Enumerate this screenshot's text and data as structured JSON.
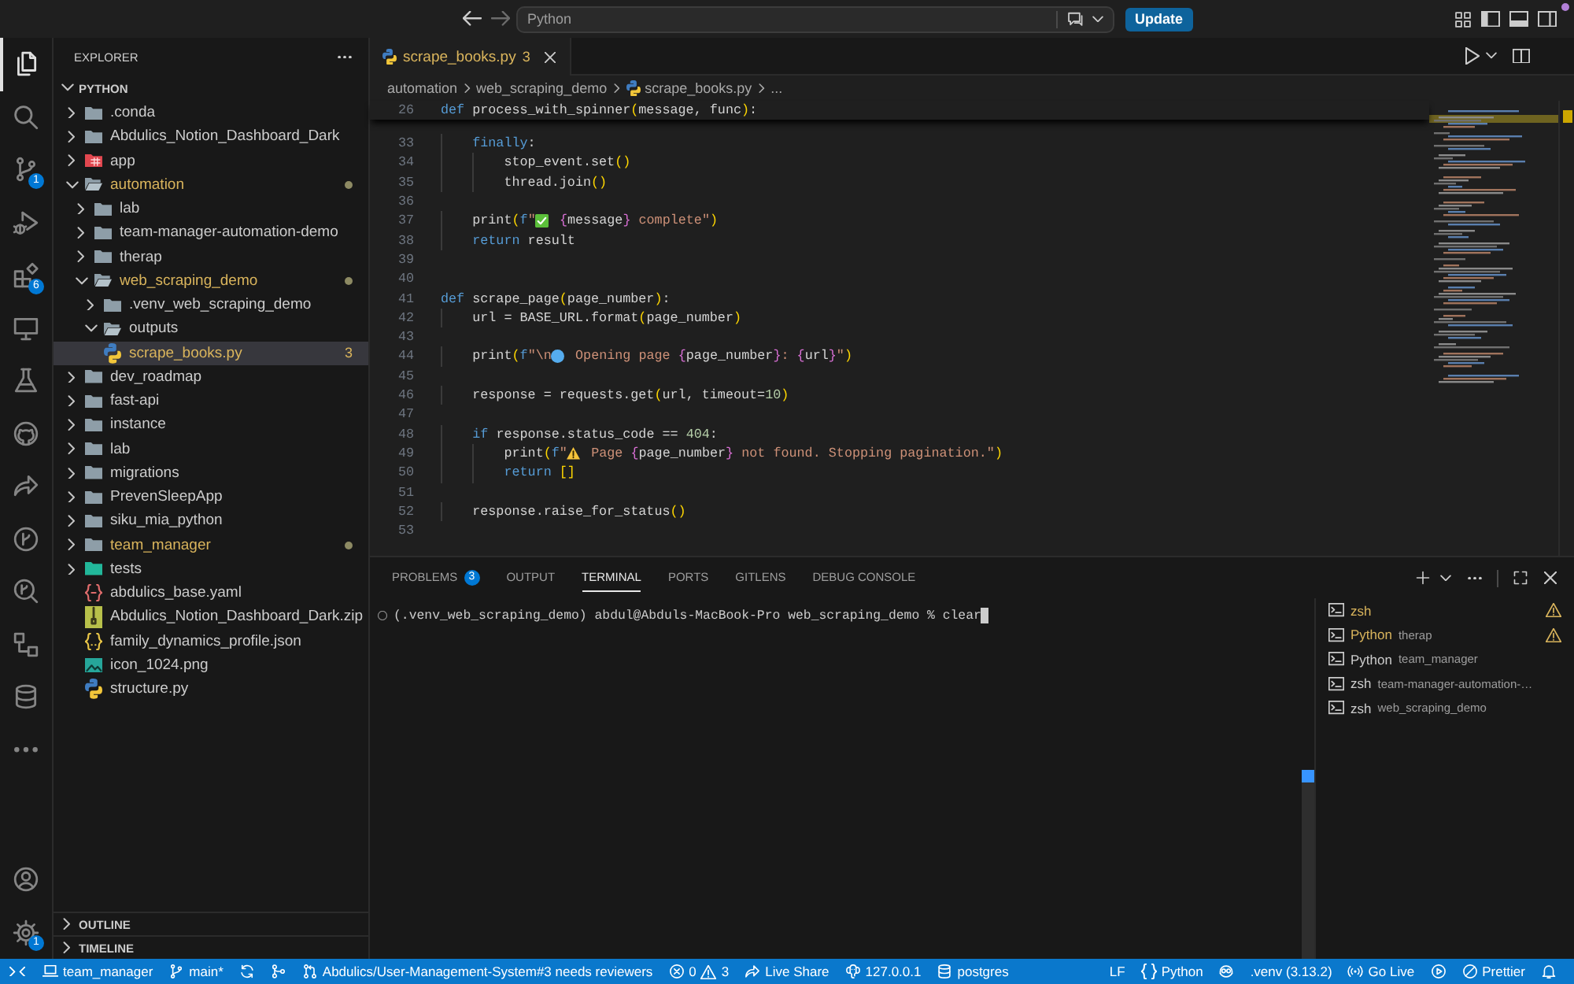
{
  "title_bar": {
    "workspace": "Python",
    "update_button": "Update"
  },
  "activity_bar": {
    "items": [
      {
        "kind": "files",
        "selected": true
      },
      {
        "kind": "search",
        "selected": false
      },
      {
        "kind": "branch",
        "selected": false,
        "badge": "1"
      },
      {
        "kind": "debug",
        "selected": false
      },
      {
        "kind": "blocks",
        "selected": false,
        "badge": "6"
      },
      {
        "kind": "monitor",
        "selected": false
      },
      {
        "kind": "flask",
        "selected": false
      },
      {
        "kind": "cat",
        "selected": false
      },
      {
        "kind": "share",
        "selected": false
      },
      {
        "kind": "gitlens",
        "selected": false
      },
      {
        "kind": "inspect",
        "selected": false
      },
      {
        "kind": "nodes",
        "selected": false
      },
      {
        "kind": "database",
        "selected": false
      },
      {
        "kind": "more",
        "selected": false
      }
    ],
    "bottom_items": [
      {
        "kind": "account"
      },
      {
        "kind": "gear",
        "badge": "1"
      }
    ]
  },
  "explorer": {
    "title": "EXPLORER",
    "section": {
      "label": "PYTHON",
      "expanded": true
    },
    "items": [
      {
        "name": ".conda",
        "kind": "folder",
        "expanded": false,
        "selected": false,
        "warning": false
      },
      {
        "name": "Abdulics_Notion_Dashboard_Dark",
        "kind": "folder",
        "expanded": false,
        "selected": false,
        "warning": false
      },
      {
        "name": "app",
        "kind": "appfolder",
        "expanded": false,
        "selected": false,
        "warning": false
      },
      {
        "name": "automation",
        "kind": "folder",
        "expanded": true,
        "selected": false,
        "warning": true,
        "children": [
          {
            "name": "lab",
            "kind": "folder",
            "expanded": false,
            "selected": false,
            "warning": false
          },
          {
            "name": "team-manager-automation-demo",
            "kind": "folder",
            "expanded": false,
            "selected": false,
            "warning": false
          },
          {
            "name": "therap",
            "kind": "folder",
            "expanded": false,
            "selected": false,
            "warning": false
          },
          {
            "name": "web_scraping_demo",
            "kind": "folder",
            "expanded": true,
            "selected": false,
            "warning": true,
            "children": [
              {
                "name": ".venv_web_scraping_demo",
                "kind": "folder",
                "expanded": false,
                "selected": false,
                "warning": false
              },
              {
                "name": "outputs",
                "kind": "folder",
                "expanded": true,
                "selected": false,
                "warning": false
              },
              {
                "name": "scrape_books.py",
                "kind": "python",
                "selected": true,
                "warning": true,
                "badge": "3"
              }
            ]
          }
        ]
      },
      {
        "name": "dev_roadmap",
        "kind": "folder",
        "expanded": false,
        "selected": false,
        "warning": false
      },
      {
        "name": "fast-api",
        "kind": "folder",
        "expanded": false,
        "selected": false,
        "warning": false
      },
      {
        "name": "instance",
        "kind": "folder",
        "expanded": false,
        "selected": false,
        "warning": false
      },
      {
        "name": "lab",
        "kind": "folder",
        "expanded": false,
        "selected": false,
        "warning": false
      },
      {
        "name": "migrations",
        "kind": "folder",
        "expanded": false,
        "selected": false,
        "warning": false
      },
      {
        "name": "PrevenSleepApp",
        "kind": "folder",
        "expanded": false,
        "selected": false,
        "warning": false
      },
      {
        "name": "siku_mia_python",
        "kind": "folder",
        "expanded": false,
        "selected": false,
        "warning": false
      },
      {
        "name": "team_manager",
        "kind": "folder",
        "expanded": false,
        "selected": false,
        "warning": true
      },
      {
        "name": "tests",
        "kind": "testfolder",
        "expanded": false,
        "selected": false,
        "warning": false
      },
      {
        "name": "abdulics_base.yaml",
        "kind": "yaml",
        "selected": false,
        "warning": false
      },
      {
        "name": "Abdulics_Notion_Dashboard_Dark.zip",
        "kind": "archive",
        "selected": false,
        "warning": false
      },
      {
        "name": "family_dynamics_profile.json",
        "kind": "json",
        "selected": false,
        "warning": false
      },
      {
        "name": "icon_1024.png",
        "kind": "image",
        "selected": false,
        "warning": false
      },
      {
        "name": "structure.py",
        "kind": "python",
        "selected": false,
        "warning": false
      }
    ],
    "panels": [
      {
        "label": "OUTLINE",
        "expanded": false
      },
      {
        "label": "TIMELINE",
        "expanded": false
      }
    ]
  },
  "editor": {
    "tabs": [
      {
        "label": "scrape_books.py",
        "kind": "python",
        "badge": "3",
        "selected": true,
        "warning": true
      }
    ],
    "breadcrumbs": [
      {
        "label": "automation",
        "kind": "folder"
      },
      {
        "label": "web_scraping_demo",
        "kind": "folder"
      },
      {
        "label": "scrape_books.py",
        "kind": "python"
      },
      {
        "label": "...",
        "kind": "symbol"
      }
    ],
    "sticky_line": {
      "number": "26",
      "tokens": [
        {
          "kind": "kw",
          "text": "def"
        },
        {
          "kind": "id",
          "text": " process_with_spinner"
        },
        {
          "kind": "br",
          "text": "("
        },
        {
          "kind": "id",
          "text": "message, func"
        },
        {
          "kind": "br",
          "text": ")"
        },
        {
          "kind": "id",
          "text": ":"
        }
      ]
    },
    "lines": [
      {
        "number": "33",
        "tokens": [
          {
            "kind": "kw",
            "text": "    finally"
          },
          {
            "kind": "id",
            "text": ":"
          }
        ]
      },
      {
        "number": "34",
        "tokens": [
          {
            "kind": "id",
            "text": "        stop_event.set"
          },
          {
            "kind": "br",
            "text": "()"
          }
        ]
      },
      {
        "number": "35",
        "tokens": [
          {
            "kind": "id",
            "text": "        thread.join"
          },
          {
            "kind": "br",
            "text": "()"
          }
        ]
      },
      {
        "number": "36"
      },
      {
        "number": "37",
        "tokens": [
          {
            "kind": "id",
            "text": "    print"
          },
          {
            "kind": "br",
            "text": "("
          },
          {
            "kind": "kw",
            "text": "f"
          },
          {
            "kind": "str",
            "text": "\""
          },
          {
            "kind": "tick"
          },
          {
            "kind": "fb",
            "text": " {"
          },
          {
            "kind": "id",
            "text": "message"
          },
          {
            "kind": "fb",
            "text": "}"
          },
          {
            "kind": "str",
            "text": " complete\""
          },
          {
            "kind": "br",
            "text": ")"
          }
        ]
      },
      {
        "number": "38",
        "tokens": [
          {
            "kind": "kw",
            "text": "    return"
          },
          {
            "kind": "id",
            "text": " result"
          }
        ]
      },
      {
        "number": "39"
      },
      {
        "number": "40"
      },
      {
        "number": "41",
        "tokens": [
          {
            "kind": "kw",
            "text": "def"
          },
          {
            "kind": "id",
            "text": " scrape_page"
          },
          {
            "kind": "br",
            "text": "("
          },
          {
            "kind": "id",
            "text": "page_number"
          },
          {
            "kind": "br",
            "text": ")"
          },
          {
            "kind": "id",
            "text": ":"
          }
        ]
      },
      {
        "number": "42",
        "tokens": [
          {
            "kind": "id",
            "text": "    url = BASE_URL.format"
          },
          {
            "kind": "br",
            "text": "("
          },
          {
            "kind": "id",
            "text": "page_number"
          },
          {
            "kind": "br",
            "text": ")"
          }
        ]
      },
      {
        "number": "43"
      },
      {
        "number": "44",
        "tokens": [
          {
            "kind": "id",
            "text": "    print"
          },
          {
            "kind": "br",
            "text": "("
          },
          {
            "kind": "kw",
            "text": "f"
          },
          {
            "kind": "str",
            "text": "\"\\n"
          },
          {
            "kind": "dot"
          },
          {
            "kind": "str",
            "text": " Opening page "
          },
          {
            "kind": "fb",
            "text": "{"
          },
          {
            "kind": "id",
            "text": "page_number"
          },
          {
            "kind": "fb",
            "text": "}"
          },
          {
            "kind": "str",
            "text": ": "
          },
          {
            "kind": "fb",
            "text": "{"
          },
          {
            "kind": "id",
            "text": "url"
          },
          {
            "kind": "fb",
            "text": "}"
          },
          {
            "kind": "str",
            "text": "\""
          },
          {
            "kind": "br",
            "text": ")"
          }
        ]
      },
      {
        "number": "45"
      },
      {
        "number": "46",
        "tokens": [
          {
            "kind": "id",
            "text": "    response = requests.get"
          },
          {
            "kind": "br",
            "text": "("
          },
          {
            "kind": "id",
            "text": "url, timeout="
          },
          {
            "kind": "num",
            "text": "10"
          },
          {
            "kind": "br",
            "text": ")"
          }
        ]
      },
      {
        "number": "47"
      },
      {
        "number": "48",
        "tokens": [
          {
            "kind": "kw",
            "text": "    if"
          },
          {
            "kind": "id",
            "text": " response.status_code == "
          },
          {
            "kind": "num",
            "text": "404"
          },
          {
            "kind": "id",
            "text": ":"
          }
        ]
      },
      {
        "number": "49",
        "tokens": [
          {
            "kind": "id",
            "text": "        print"
          },
          {
            "kind": "br",
            "text": "("
          },
          {
            "kind": "kw",
            "text": "f"
          },
          {
            "kind": "str",
            "text": "\""
          },
          {
            "kind": "alert"
          },
          {
            "kind": "str",
            "text": " Page "
          },
          {
            "kind": "fb",
            "text": "{"
          },
          {
            "kind": "id",
            "text": "page_number"
          },
          {
            "kind": "fb",
            "text": "}"
          },
          {
            "kind": "str",
            "text": " not found. Stopping pagination.\""
          },
          {
            "kind": "br",
            "text": ")"
          }
        ]
      },
      {
        "number": "50",
        "tokens": [
          {
            "kind": "kw",
            "text": "        return"
          },
          {
            "kind": "br",
            "text": " []"
          }
        ]
      },
      {
        "number": "51"
      },
      {
        "number": "52",
        "tokens": [
          {
            "kind": "id",
            "text": "    response.raise_for_status"
          },
          {
            "kind": "br",
            "text": "()"
          }
        ]
      },
      {
        "number": "53"
      }
    ]
  },
  "panel": {
    "tabs": [
      {
        "label": "PROBLEMS",
        "badge": "3",
        "selected": false
      },
      {
        "label": "OUTPUT",
        "selected": false
      },
      {
        "label": "TERMINAL",
        "selected": true
      },
      {
        "label": "PORTS",
        "selected": false
      },
      {
        "label": "GITLENS",
        "selected": false
      },
      {
        "label": "DEBUG CONSOLE",
        "selected": false
      }
    ],
    "terminal": {
      "prompt": "(.venv_web_scraping_demo) abdul@Abduls-MacBook-Pro web_scraping_demo % clear"
    },
    "terminals": [
      {
        "name": "zsh",
        "warning": true
      },
      {
        "name": "Python",
        "detail": "therap",
        "warning": true
      },
      {
        "name": "Python",
        "detail": "team_manager",
        "warning": false
      },
      {
        "name": "zsh",
        "detail": "team-manager-automation-…",
        "warning": false
      },
      {
        "name": "zsh",
        "detail": "web_scraping_demo",
        "warning": false
      }
    ]
  },
  "status_bar": {
    "left": [
      {
        "kind": "remote"
      },
      {
        "kind": "folder",
        "label": "team_manager"
      },
      {
        "kind": "branch",
        "label": "main*"
      },
      {
        "kind": "sync"
      },
      {
        "kind": "graph"
      },
      {
        "kind": "pullrequest",
        "label": "Abdulics/User-Management-System#3 needs reviewers"
      },
      {
        "kind": "problems",
        "errors": "0",
        "warnings": "3"
      },
      {
        "kind": "liveshare",
        "label": "Live Share"
      },
      {
        "kind": "server",
        "label": "127.0.0.1"
      },
      {
        "kind": "database",
        "label": "postgres"
      }
    ],
    "right": [
      {
        "kind": "eol",
        "label": "LF"
      },
      {
        "kind": "language",
        "label": "Python"
      },
      {
        "kind": "copilot"
      },
      {
        "kind": "interpreter",
        "label": ".venv (3.13.2)"
      },
      {
        "kind": "golive",
        "label": "Go Live"
      },
      {
        "kind": "run"
      },
      {
        "kind": "prettier",
        "label": "Prettier"
      },
      {
        "kind": "bell"
      }
    ]
  }
}
